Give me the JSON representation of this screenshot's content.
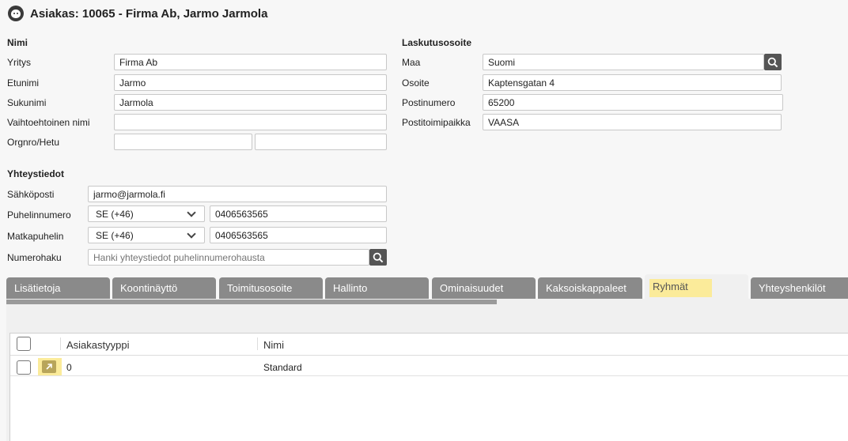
{
  "header": {
    "title": "Asiakas: 10065 - Firma Ab, Jarmo Jarmola"
  },
  "name_section": {
    "heading": "Nimi",
    "company_label": "Yritys",
    "company": "Firma Ab",
    "firstname_label": "Etunimi",
    "firstname": "Jarmo",
    "lastname_label": "Sukunimi",
    "lastname": "Jarmola",
    "altname_label": "Vaihtoehtoinen nimi",
    "altname": "",
    "orgnr_label": "Orgnro/Hetu",
    "orgnr": "",
    "orgnr2": ""
  },
  "billing": {
    "heading": "Laskutusosoite",
    "country_label": "Maa",
    "country": "Suomi",
    "address_label": "Osoite",
    "address": "Kaptensgatan 4",
    "postcode_label": "Postinumero",
    "postcode": "65200",
    "city_label": "Postitoimipaikka",
    "city": "VAASA"
  },
  "contact": {
    "heading": "Yhteystiedot",
    "email_label": "Sähköposti",
    "email": "jarmo@jarmola.fi",
    "phone_label": "Puhelinnumero",
    "phone_country": "SE (+46)",
    "phone": "0406563565",
    "mobile_label": "Matkapuhelin",
    "mobile_country": "SE (+46)",
    "mobile": "0406563565",
    "lookup_label": "Numerohaku",
    "lookup_placeholder": "Hanki yhteystiedot puhelinnumerohausta"
  },
  "tabs": [
    {
      "label": "Lisätietoja"
    },
    {
      "label": "Koontinäyttö"
    },
    {
      "label": "Toimitusosoite"
    },
    {
      "label": "Hallinto"
    },
    {
      "label": "Ominaisuudet"
    },
    {
      "label": "Kaksoiskappaleet"
    },
    {
      "label": "Ryhmät"
    },
    {
      "label": "Yhteyshenkilöt"
    }
  ],
  "grid": {
    "columns": [
      "Asiakastyyppi",
      "Nimi"
    ],
    "rows": [
      {
        "type": "0",
        "name": "Standard"
      }
    ]
  },
  "colors": {
    "tab_bg": "#8a8a8a",
    "highlight": "#fbeb9a",
    "search_button": "#555555"
  }
}
